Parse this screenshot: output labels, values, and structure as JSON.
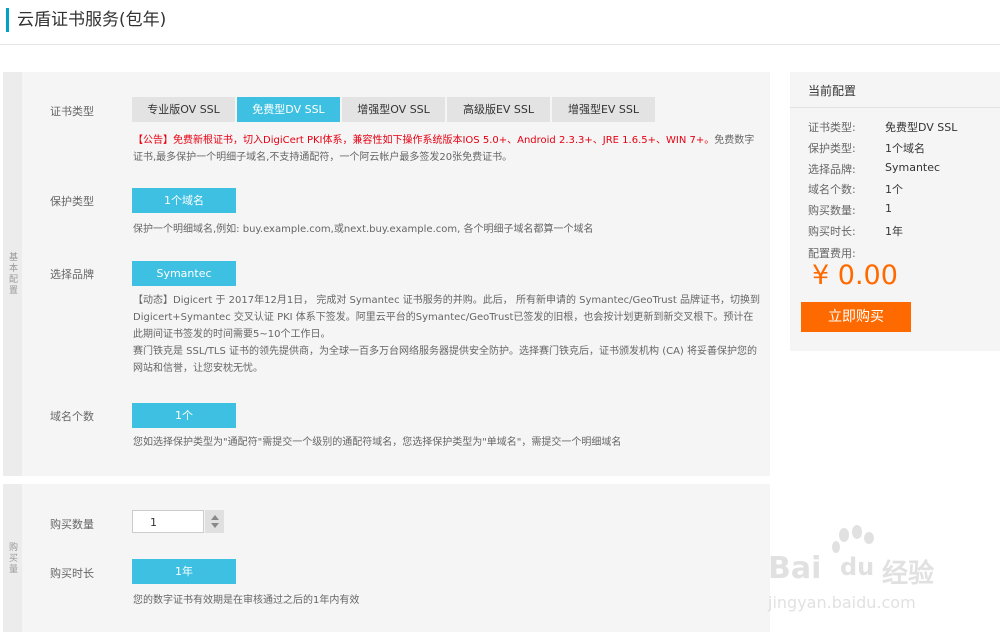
{
  "page": {
    "title": "云盾证书服务(包年)"
  },
  "basic": {
    "side_label": "基本配置",
    "cert_type": {
      "label": "证书类型",
      "options": [
        "专业版OV SSL",
        "免费型DV SSL",
        "增强型OV SSL",
        "高级版EV SSL",
        "增强型EV SSL"
      ],
      "selected": "免费型DV SSL",
      "notice_red": "【公告】免费新根证书，切入DigiCert PKI体系，兼容性如下操作系统版本IOS 5.0+、Android 2.3.3+、JRE 1.6.5+、WIN 7+。",
      "notice_rest": "免费数字证书,最多保护一个明细子域名,不支持通配符，一个阿云帐户最多签发20张免费证书。"
    },
    "protect_type": {
      "label": "保护类型",
      "option": "1个域名",
      "desc": "保护一个明细域名,例如: buy.example.com,或next.buy.example.com, 各个明细子域名都算一个域名"
    },
    "brand": {
      "label": "选择品牌",
      "option": "Symantec",
      "desc1": "【动态】Digicert 于 2017年12月1日， 完成对 Symantec 证书服务的并购。此后， 所有新申请的 Symantec/GeoTrust 品牌证书，切换到Digicert+Symantec 交叉认证 PKI 体系下签发。阿里云平台的Symantec/GeoTrust已签发的旧根，也会按计划更新到新交叉根下。预计在此期间证书签发的时间需要5~10个工作日。",
      "desc2": "赛门铁克是 SSL/TLS 证书的领先提供商，为全球一百多万台网络服务器提供安全防护。选择赛门铁克后，证书颁发机构 (CA) 将妥善保护您的网站和信誉，让您安枕无忧。"
    },
    "domain_count": {
      "label": "域名个数",
      "option": "1个",
      "desc": "您如选择保护类型为\"通配符\"需提交一个级别的通配符域名，您选择保护类型为\"单域名\"，需提交一个明细域名"
    }
  },
  "purchase": {
    "side_label": "购买量",
    "quantity": {
      "label": "购买数量",
      "value": "1"
    },
    "duration": {
      "label": "购买时长",
      "option": "1年",
      "desc": "您的数字证书有效期是在审核通过之后的1年内有效"
    }
  },
  "config": {
    "title": "当前配置",
    "rows": [
      {
        "key": "证书类型:",
        "value": "免费型DV SSL"
      },
      {
        "key": "保护类型:",
        "value": "1个域名"
      },
      {
        "key": "选择品牌:",
        "value": "Symantec"
      },
      {
        "key": "域名个数:",
        "value": "1个"
      },
      {
        "key": "购买数量:",
        "value": "1"
      },
      {
        "key": "购买时长:",
        "value": "1年"
      }
    ],
    "cost_label": "配置费用:",
    "price": "¥ 0.00",
    "buy_button": "立即购买"
  },
  "watermark": {
    "brand_bai": "Bai",
    "brand_du": "du",
    "brand_jy": "经验",
    "url": "jingyan.baidu.com"
  },
  "colors": {
    "accent": "#3ec0e3",
    "title_bar": "#00a2ca",
    "orange": "#ff6a00",
    "notice_red": "#e60012"
  }
}
